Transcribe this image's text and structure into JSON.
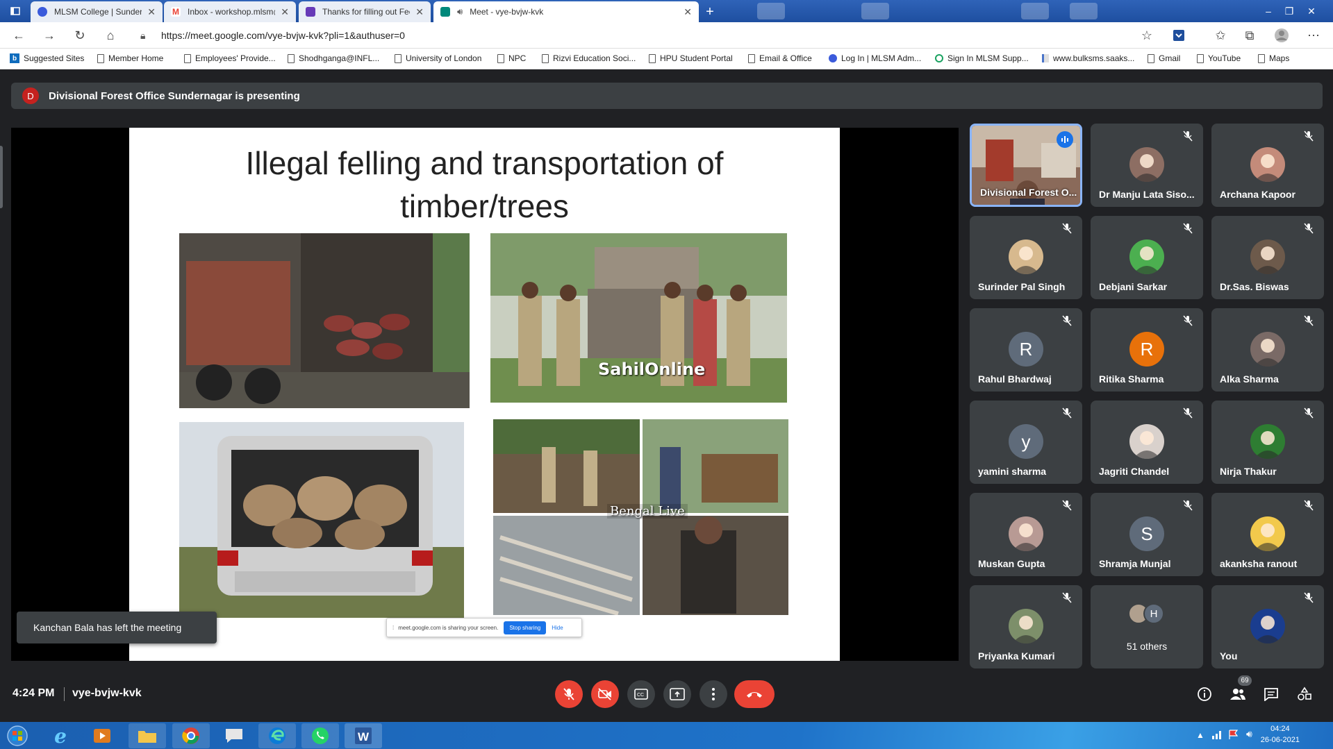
{
  "browser": {
    "tabs": [
      {
        "title": "MLSM College | Sundernagar, M",
        "favicon_color": "#3b5bdb"
      },
      {
        "title": "Inbox - workshop.mlsm@gmail.c",
        "favicon_color": "#ea4335"
      },
      {
        "title": "Thanks for filling out Feedback f",
        "favicon_color": "#673ab7"
      },
      {
        "title": "Meet - vye-bvjw-kvk",
        "favicon_color": "#00897b"
      }
    ],
    "url": "https://meet.google.com/vye-bvjw-kvk?pli=1&authuser=0",
    "bookmarks": [
      "Suggested Sites",
      "Member Home",
      "Employees' Provide...",
      "Shodhganga@INFL...",
      "University of London",
      "NPC",
      "Rizvi Education Soci...",
      "HPU Student Portal",
      "Email & Office",
      "Log In | MLSM Adm...",
      "Sign In MLSM Supp...",
      "www.bulksms.saaks...",
      "Gmail",
      "YouTube",
      "Maps"
    ]
  },
  "meet": {
    "presenting_initial": "D",
    "presenting_text": "Divisional Forest Office Sundernagar is presenting",
    "slide": {
      "title_line1": "Illegal felling and transportation of",
      "title_line2": "timber/trees",
      "watermark1": "SahilOnline",
      "watermark2": "Bengal Live"
    },
    "share_bar": {
      "text": "meet.google.com is sharing your screen.",
      "stop": "Stop sharing",
      "hide": "Hide"
    },
    "toast": "Kanchan Bala has left the meeting",
    "participants": [
      {
        "name": "Divisional Forest O...",
        "type": "video",
        "speaking": true
      },
      {
        "name": "Dr Manju Lata Siso...",
        "type": "photo",
        "color": "#8d6e63"
      },
      {
        "name": "Archana Kapoor",
        "type": "photo",
        "color": "#c48b7a"
      },
      {
        "name": "Surinder Pal Singh",
        "type": "photo",
        "color": "#d7b98e"
      },
      {
        "name": "Debjani Sarkar",
        "type": "photo",
        "color": "#4caf50"
      },
      {
        "name": "Dr.Sas. Biswas",
        "type": "photo",
        "color": "#6d5a4b"
      },
      {
        "name": "Rahul Bhardwaj",
        "type": "letter",
        "letter": "R",
        "color": "#5f6b7a"
      },
      {
        "name": "Ritika Sharma",
        "type": "letter",
        "letter": "R",
        "color": "#e8710a"
      },
      {
        "name": "Alka Sharma",
        "type": "photo",
        "color": "#7a6a66"
      },
      {
        "name": "yamini sharma",
        "type": "letter",
        "letter": "y",
        "color": "#5f6b7a"
      },
      {
        "name": "Jagriti Chandel",
        "type": "photo",
        "color": "#d9d1cc"
      },
      {
        "name": "Nirja Thakur",
        "type": "photo",
        "color": "#2e7d32"
      },
      {
        "name": "Muskan Gupta",
        "type": "photo",
        "color": "#b89a94"
      },
      {
        "name": "Shramja Munjal",
        "type": "letter",
        "letter": "S",
        "color": "#5f6b7a"
      },
      {
        "name": "akanksha ranout",
        "type": "photo",
        "color": "#f2c94c"
      },
      {
        "name": "Priyanka Kumari",
        "type": "photo",
        "color": "#7d8f6a"
      },
      {
        "name": "51 others",
        "type": "others",
        "letter": "H"
      },
      {
        "name": "You",
        "type": "photo",
        "color": "#1a3d8f"
      }
    ],
    "time": "4:24 PM",
    "meeting_code": "vye-bvjw-kvk",
    "participant_count": "69"
  },
  "taskbar": {
    "time": "04:24",
    "date": "26-06-2021"
  }
}
